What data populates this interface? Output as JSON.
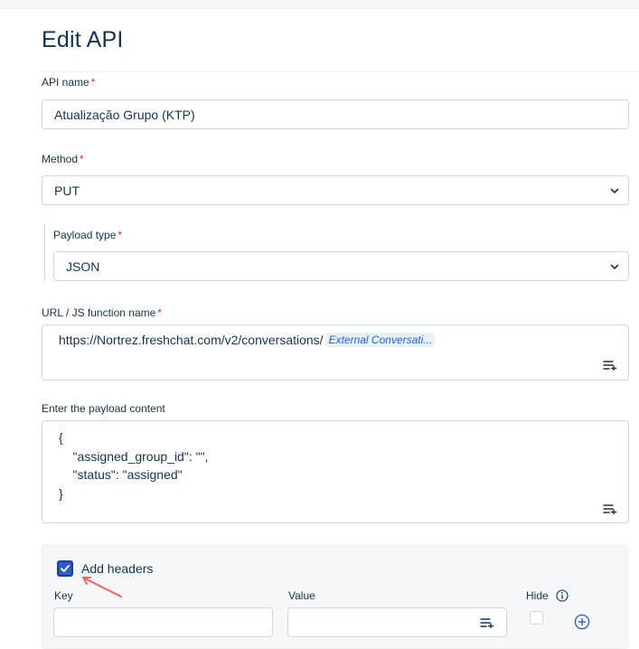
{
  "page": {
    "title": "Edit API"
  },
  "api_name": {
    "label": "API name",
    "required_mark": "*",
    "value": "Atualização Grupo (KTP)"
  },
  "method": {
    "label": "Method",
    "required_mark": "*",
    "value": "PUT"
  },
  "payload_type": {
    "label": "Payload type",
    "required_mark": "*",
    "value": "JSON"
  },
  "url": {
    "label": "URL / JS function name",
    "required_mark": "*",
    "value": "https://Nortrez.freshchat.com/v2/conversations/",
    "placeholder_chip": "External Conversati..."
  },
  "payload_content": {
    "label": "Enter the payload content",
    "lines": [
      "{",
      "    \"assigned_group_id\": \"\",",
      "    \"status\": \"assigned\"",
      "}"
    ]
  },
  "headers": {
    "checkbox_label": "Add headers",
    "checked": true,
    "key_label": "Key",
    "value_label": "Value",
    "hide_label": "Hide"
  },
  "icons": {
    "chevron": "chevron-down-icon",
    "insert": "insert-placeholder-icon",
    "info": "info-icon",
    "add": "add-circle-icon",
    "arrow": "annotation-arrow"
  },
  "colors": {
    "accent": "#2c5cc5",
    "text": "#12344d",
    "required": "#d72d30",
    "annotation": "#e8685f"
  }
}
